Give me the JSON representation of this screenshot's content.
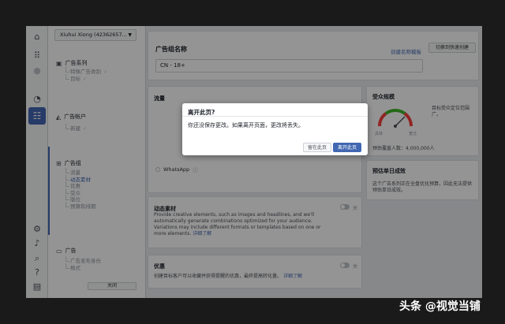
{
  "account": {
    "name": "Xiuhui Xiong (42362657..."
  },
  "sidebar": {
    "campaign": {
      "title": "广告系列",
      "items": [
        "特殊广告类别",
        "目标"
      ]
    },
    "account": {
      "title": "广告帐户",
      "items": [
        "新建"
      ]
    },
    "adset": {
      "title": "广告组",
      "items": [
        "流量",
        "动态素材",
        "优惠",
        "受众",
        "版位",
        "预算和排期"
      ]
    },
    "ad": {
      "title": "广告",
      "items": [
        "广告发布身份",
        "格式"
      ]
    },
    "close_label": "关闭"
  },
  "main": {
    "adset_name_title": "广告组名称",
    "adset_name_value": "CN - 18+",
    "create_template_link": "创建名称模板",
    "quick_create_button": "切换到快速创建",
    "traffic": {
      "title": "流量",
      "options": [
        "WhatsApp"
      ]
    },
    "dynamic_creative": {
      "title": "动态素材",
      "desc": "Provide creative elements, such as images and headlines, and we'll automatically generate combinations optimized for your audience. Variations may include different formats or templates based on one or more elements.",
      "learn_more": "详细了解",
      "toggle_label": "关"
    },
    "offer": {
      "title": "优惠",
      "desc": "创建目标客户可以收藏并获得提醒的优惠，最终提高转化量。",
      "learn_more": "详细了解",
      "toggle_label": "关"
    },
    "audience_size": {
      "title": "受众规模",
      "desc": "目标受众定位范围广。",
      "narrow": "具体",
      "broad": "宽泛",
      "reach_label": "预估覆盖人数：",
      "reach_value": "4,000,000人"
    },
    "daily_results": {
      "title": "预估单日成效",
      "desc": "这个广告系列正在全盘优化预算，因此无法提供预估单日成效。"
    }
  },
  "dialog": {
    "title": "离开此页?",
    "message": "你还没保存更改。如果离开页面，更改将丢失。",
    "stay_button": "留在此页",
    "leave_button": "离开此页"
  },
  "watermark": "头条 @视觉当铺",
  "colors": {
    "accent": "#4267b2",
    "overlay": "rgba(0,0,0,0.42)"
  }
}
